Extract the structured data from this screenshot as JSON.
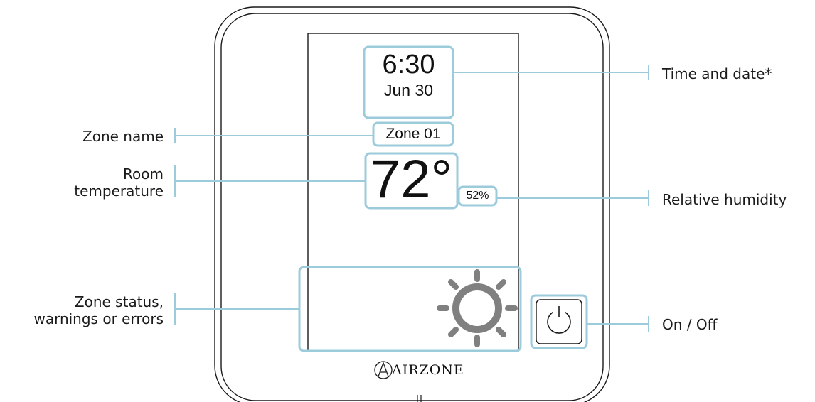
{
  "display": {
    "time": "6:30",
    "date": "Jun 30",
    "zone_name": "Zone 01",
    "temperature": "72°",
    "humidity": "52%",
    "brand": "AIRZONE"
  },
  "callouts": {
    "time_and_date": "Time and date*",
    "zone_name": "Zone name",
    "room_temperature_line1": "Room",
    "room_temperature_line2": "temperature",
    "relative_humidity": "Relative humidity",
    "zone_status_line1": "Zone status,",
    "zone_status_line2": "warnings or errors",
    "on_off": "On / Off"
  },
  "icons": [
    "sun-icon",
    "power-icon"
  ],
  "colors": {
    "highlight": "#9ccbdc",
    "device_outline": "#1a1a1a",
    "sun": "#808080"
  }
}
